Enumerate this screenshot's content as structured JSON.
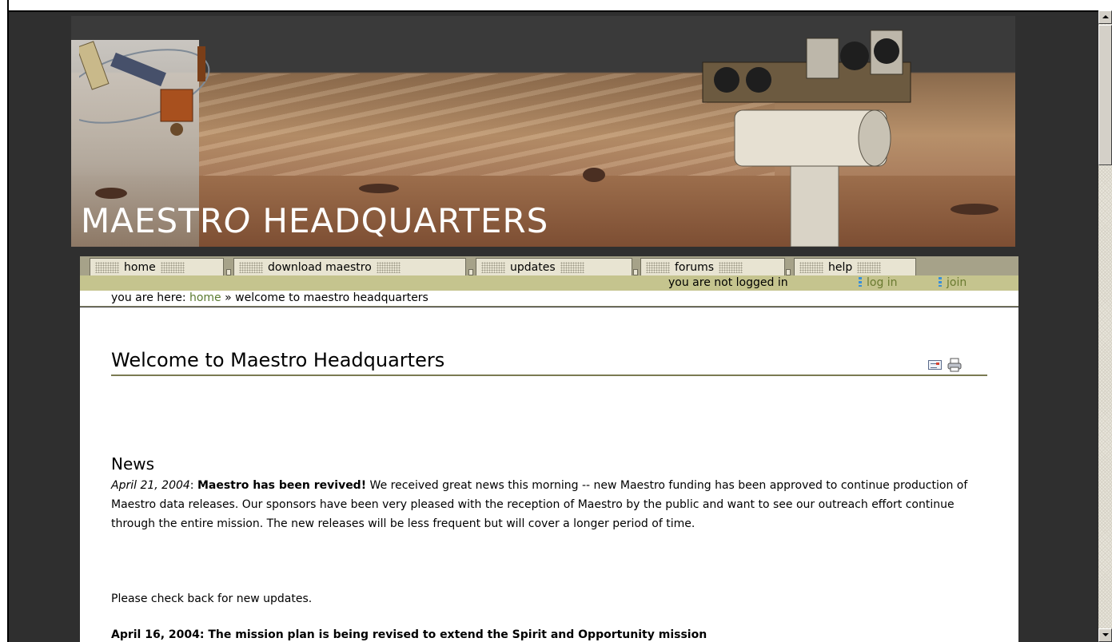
{
  "site": {
    "title_part1": "MAESTR",
    "title_part2": "O",
    "title_part3": " HEADQUARTERS"
  },
  "nav": {
    "tabs": [
      {
        "label": "home"
      },
      {
        "label": "download maestro"
      },
      {
        "label": "updates"
      },
      {
        "label": "forums"
      },
      {
        "label": "help"
      }
    ]
  },
  "status": {
    "login_state": "you are not logged in",
    "login_link": "log in",
    "join_link": "join"
  },
  "breadcrumb": {
    "prefix": "you are here: ",
    "home": "home",
    "separator": " » ",
    "current": "welcome to maestro headquarters"
  },
  "page": {
    "title": "Welcome to Maestro Headquarters",
    "email_icon": "email-icon",
    "print_icon": "printer-icon"
  },
  "news": {
    "heading": "News",
    "item1_date": "April 21, 2004",
    "item1_colon": ": ",
    "item1_headline": "Maestro has been revived!",
    "item1_body": " We received great news this morning -- new Maestro funding has been approved to continue production of Maestro data releases. Our sponsors have been very pleased with the reception of Maestro by the public and want to see our outreach effort continue through the entire mission. The new releases will be less frequent but will cover a longer period of time.",
    "check_back": "Please check back for new updates.",
    "item2_partial": "April 16, 2004: The mission plan is being revised to extend the Spirit and Opportunity mission"
  },
  "colors": {
    "background": "#2f2f2f",
    "tab_bar": "#a6a289",
    "status_bar": "#c5c48e",
    "link": "#5a7a30"
  }
}
